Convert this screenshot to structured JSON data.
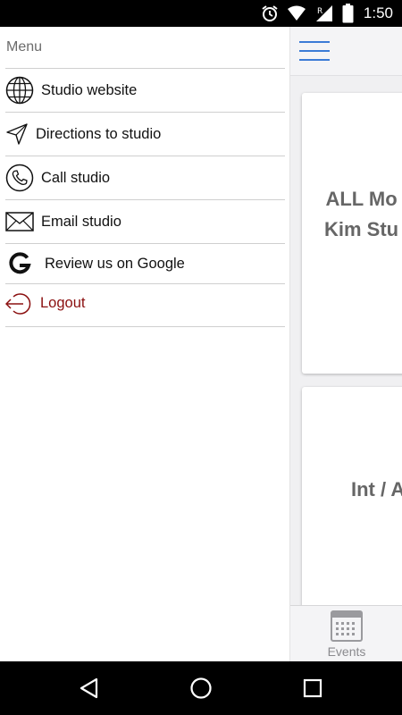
{
  "status_bar": {
    "time": "1:50",
    "battery_level": "80",
    "icons": [
      "alarm-icon",
      "wifi-icon",
      "signal-roaming-icon",
      "battery-icon"
    ]
  },
  "drawer": {
    "title": "Menu",
    "items": [
      {
        "label": "Studio website",
        "icon": "globe-icon"
      },
      {
        "label": "Directions to studio",
        "icon": "navigation-arrow-icon"
      },
      {
        "label": "Call studio",
        "icon": "phone-icon"
      },
      {
        "label": "Email studio",
        "icon": "envelope-icon"
      },
      {
        "label": "Review us on Google",
        "icon": "google-icon"
      },
      {
        "label": "Logout",
        "icon": "logout-icon"
      }
    ],
    "logout_color": "#8b1010"
  },
  "background_app": {
    "cards": [
      {
        "title_line1": "ALL Mo",
        "title_line2": "Kim Stu"
      },
      {
        "title_line1": "Int / A"
      }
    ],
    "tabbar": {
      "events_label": "Events"
    },
    "accent_color": "#3b7bd6"
  },
  "nav_bar": {
    "buttons": [
      "back-icon",
      "home-icon",
      "recents-icon"
    ]
  }
}
